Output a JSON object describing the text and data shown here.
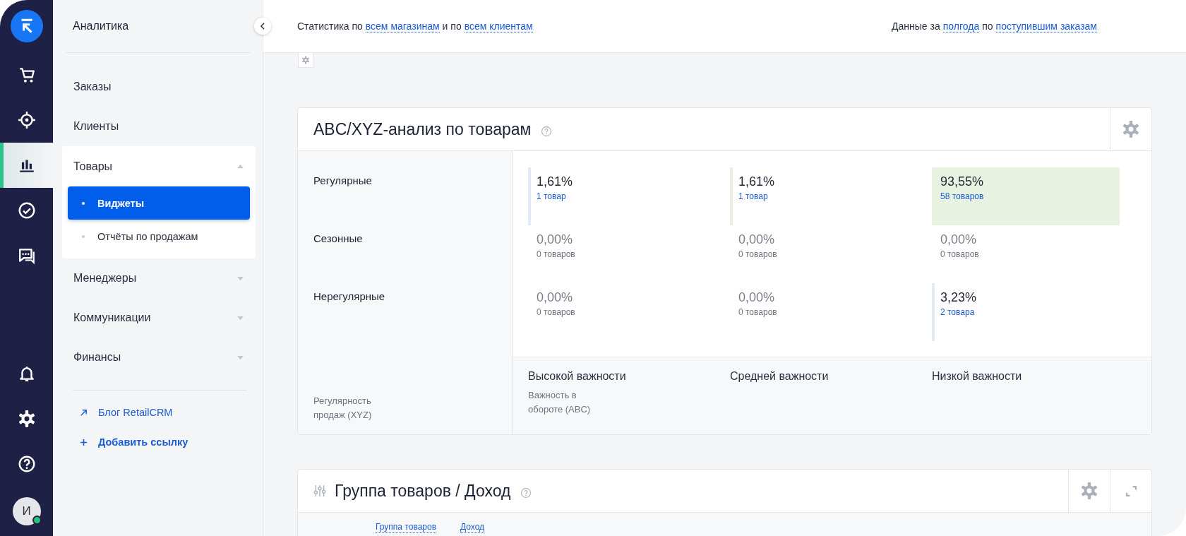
{
  "rail": {
    "items": [
      {
        "kind": "cart",
        "selected": false
      },
      {
        "kind": "target",
        "selected": false
      },
      {
        "kind": "chart",
        "selected": true
      },
      {
        "kind": "check",
        "selected": false
      },
      {
        "kind": "chat",
        "selected": false
      }
    ],
    "bottom": [
      {
        "kind": "bell"
      },
      {
        "kind": "gear"
      },
      {
        "kind": "help"
      }
    ],
    "avatar": {
      "initial": "И",
      "online": true
    }
  },
  "sidebar": {
    "title": "Аналитика",
    "items": [
      {
        "label": "Заказы",
        "kind": "link"
      },
      {
        "label": "Клиенты",
        "kind": "link"
      },
      {
        "label": "Товары",
        "kind": "group",
        "expanded": true,
        "children": [
          {
            "label": "Виджеты",
            "selected": true
          },
          {
            "label": "Отчёты по продажам",
            "selected": false
          }
        ]
      },
      {
        "label": "Менеджеры",
        "kind": "group",
        "expanded": false
      },
      {
        "label": "Коммуникации",
        "kind": "group",
        "expanded": false
      },
      {
        "label": "Финансы",
        "kind": "group",
        "expanded": false
      }
    ],
    "links": [
      {
        "label": "Блог RetailCRM",
        "kind": "external"
      },
      {
        "label": "Добавить ссылку",
        "kind": "add"
      }
    ]
  },
  "top_bar": {
    "left": [
      {
        "text": "Статистика по",
        "kind": "text"
      },
      {
        "text": "всем магазинам",
        "kind": "link"
      },
      {
        "text": "и по",
        "kind": "text"
      },
      {
        "text": "всем клиентам",
        "kind": "link"
      }
    ],
    "right": [
      {
        "text": "Данные за",
        "kind": "text"
      },
      {
        "text": "полгода",
        "kind": "link"
      },
      {
        "text": "по",
        "kind": "text"
      },
      {
        "text": "поступившим заказам",
        "kind": "link"
      }
    ]
  },
  "abc_widget": {
    "title": "ABC/XYZ-анализ по товарам",
    "rows": [
      {
        "label": "Регулярные",
        "cells": [
          {
            "percent": "1,61%",
            "count": "1 товар",
            "kind": "bar",
            "color": "#e3eaf3",
            "empty": false
          },
          {
            "percent": "1,61%",
            "count": "1 товар",
            "kind": "bar",
            "color": "#e7f2e0",
            "empty": false
          },
          {
            "percent": "93,55%",
            "count": "58 товаров",
            "kind": "fill",
            "color": "#e7f2e0",
            "empty": false
          }
        ]
      },
      {
        "label": "Сезонные",
        "cells": [
          {
            "percent": "0,00%",
            "count": "0 товаров",
            "kind": "plain",
            "empty": true
          },
          {
            "percent": "0,00%",
            "count": "0 товаров",
            "kind": "plain",
            "empty": true
          },
          {
            "percent": "0,00%",
            "count": "0 товаров",
            "kind": "plain",
            "empty": true
          }
        ]
      },
      {
        "label": "Нерегулярные",
        "cells": [
          {
            "percent": "0,00%",
            "count": "0 товаров",
            "kind": "plain",
            "empty": true
          },
          {
            "percent": "0,00%",
            "count": "0 товаров",
            "kind": "plain",
            "empty": true
          },
          {
            "percent": "3,23%",
            "count": "2 товара",
            "kind": "bar",
            "color": "#e3eaf3",
            "empty": false
          }
        ]
      }
    ],
    "importance_labels": [
      "Высокой важности",
      "Средней важности",
      "Низкой важности"
    ],
    "y_axis_label": "Регулярность продаж (XYZ)",
    "x_axis_label": "Важность в обороте (ABC)"
  },
  "group_widget": {
    "title": "Группа товаров / Доход",
    "columns": [
      "Группа товаров",
      "Доход"
    ]
  }
}
